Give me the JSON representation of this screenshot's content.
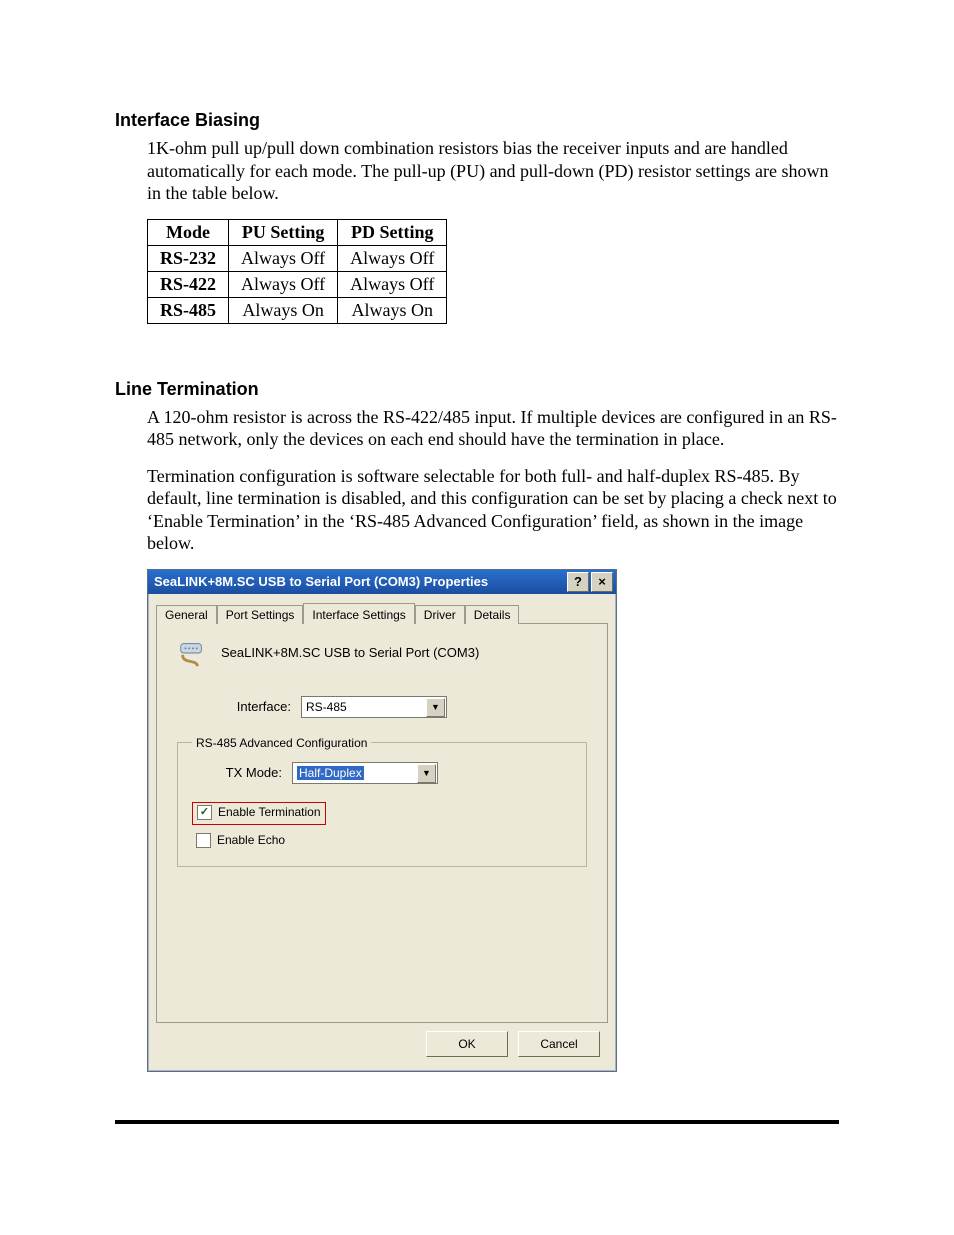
{
  "sections": {
    "biasing": {
      "heading": "Interface Biasing",
      "para": "1K-ohm pull up/pull down combination resistors bias the receiver inputs and are handled automatically for each mode. The pull-up (PU) and pull-down (PD) resistor settings are shown in the table below."
    },
    "termination": {
      "heading": "Line Termination",
      "para1": "A 120-ohm resistor is across the RS-422/485 input. If multiple devices are configured in an RS-485 network, only the devices on each end should have the termination in place.",
      "para2": "Termination configuration is software selectable for both full- and half-duplex RS-485. By default, line termination is disabled, and this configuration can be set by placing a check next to ‘Enable Termination’ in the ‘RS-485 Advanced Configuration’ field, as shown in the image below."
    }
  },
  "table": {
    "headers": [
      "Mode",
      "PU Setting",
      "PD Setting"
    ],
    "rows": [
      [
        "RS-232",
        "Always Off",
        "Always Off"
      ],
      [
        "RS-422",
        "Always Off",
        "Always Off"
      ],
      [
        "RS-485",
        "Always On",
        "Always On"
      ]
    ]
  },
  "dialog": {
    "title": "SeaLINK+8M.SC USB to Serial Port (COM3) Properties",
    "help_icon": "?",
    "close_icon": "×",
    "tabs": [
      "General",
      "Port Settings",
      "Interface Settings",
      "Driver",
      "Details"
    ],
    "active_tab_index": 2,
    "device_name": "SeaLINK+8M.SC USB to Serial Port (COM3)",
    "interface_label": "Interface:",
    "interface_value": "RS-485",
    "group_legend": "RS-485 Advanced Configuration",
    "txmode_label": "TX Mode:",
    "txmode_value": "Half-Duplex",
    "enable_termination_label": "Enable Termination",
    "enable_termination_checked": true,
    "enable_echo_label": "Enable Echo",
    "enable_echo_checked": false,
    "ok_label": "OK",
    "cancel_label": "Cancel"
  }
}
